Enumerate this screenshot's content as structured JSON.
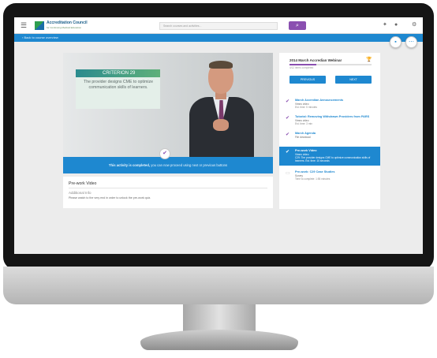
{
  "app": {
    "logo_name": "Accreditation Council",
    "logo_sub": "for Continuing Medical Education",
    "search_placeholder": "Search courses and activities...",
    "breadcrumb": "Back to course overview"
  },
  "video": {
    "criterion_title": "CRITERION 29",
    "criterion_text": "The provider designs CME to optimize communication skills of learners.",
    "status_prefix": "This activity is completed,",
    "status_rest": "you can now proceed using next or previous buttons"
  },
  "info": {
    "title": "Pre-work Video",
    "subtitle": "Additional Info",
    "description": "Please watch to the very end in order to unlock the pre-work quiz."
  },
  "playlist": {
    "webinar_title": "2014 March Accredian Webinar",
    "progress_label": "4/12 items completed",
    "progress_fraction": 0.33,
    "previous_label": "PREVIOUS",
    "next_label": "NEXT",
    "items": [
      {
        "title": "March Accredian Announcements",
        "type": "Vimeo video",
        "time": "Est. time: 5 minutes",
        "state": "done"
      },
      {
        "title": "Tutorial: Removing Withdrawn Providers from PARS",
        "type": "Vimeo video",
        "time": "Est. time: 3 min",
        "state": "done"
      },
      {
        "title": "March Agenda",
        "type": "File download",
        "time": "",
        "state": "done"
      },
      {
        "title": "Pre-work Video",
        "type": "Vimeo video",
        "time": "C29: The provider designs CME to optimize communication skills of learners. Est. time: 10 seconds",
        "state": "active"
      },
      {
        "title": "Pre-work: C29 Case Studies",
        "type": "Survey",
        "time": "Time to complete: 1:55 minutes",
        "state": "todo"
      }
    ]
  },
  "colors": {
    "accent": "#1e88d0",
    "brand_purple": "#8a4fb0"
  }
}
